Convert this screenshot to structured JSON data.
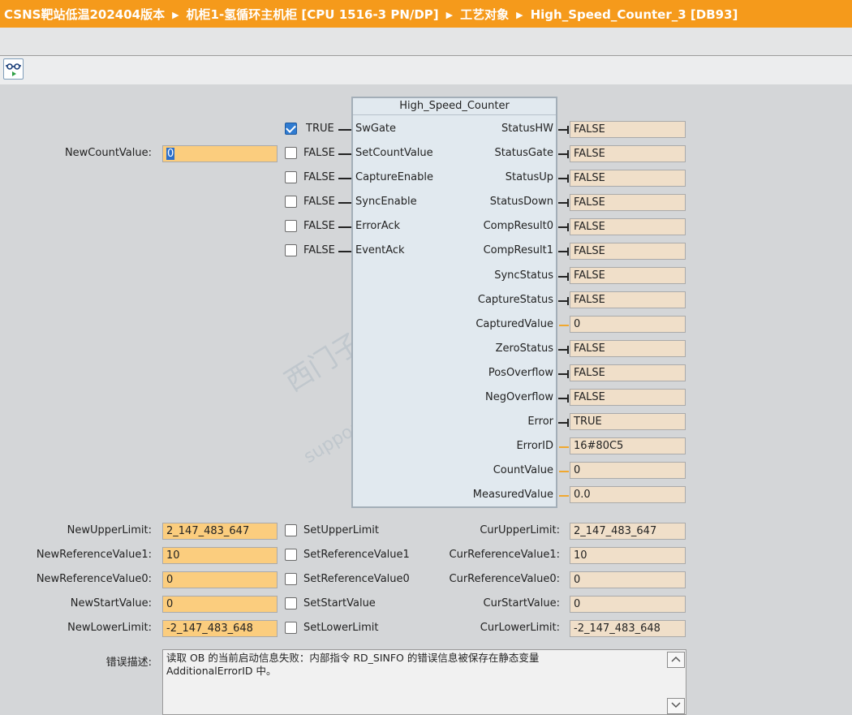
{
  "breadcrumb": {
    "items": [
      "CSNS靶站低温202404版本",
      "机柜1-氢循环主机柜 [CPU 1516-3 PN/DP]",
      "工艺对象",
      "High_Speed_Counter_3 [DB93]"
    ],
    "separator": "▶"
  },
  "toolbar": {
    "monitor_icon": "glasses-monitor-icon"
  },
  "block": {
    "title": "High_Speed_Counter",
    "inputs": [
      {
        "name": "SwGate",
        "value": "TRUE",
        "checked": true
      },
      {
        "name": "SetCountValue",
        "value": "FALSE",
        "checked": false
      },
      {
        "name": "CaptureEnable",
        "value": "FALSE",
        "checked": false
      },
      {
        "name": "SyncEnable",
        "value": "FALSE",
        "checked": false
      },
      {
        "name": "ErrorAck",
        "value": "FALSE",
        "checked": false
      },
      {
        "name": "EventAck",
        "value": "FALSE",
        "checked": false
      }
    ],
    "outputs": [
      {
        "name": "StatusHW",
        "value": "FALSE"
      },
      {
        "name": "StatusGate",
        "value": "FALSE"
      },
      {
        "name": "StatusUp",
        "value": "FALSE"
      },
      {
        "name": "StatusDown",
        "value": "FALSE"
      },
      {
        "name": "CompResult0",
        "value": "FALSE"
      },
      {
        "name": "CompResult1",
        "value": "FALSE"
      },
      {
        "name": "SyncStatus",
        "value": "FALSE"
      },
      {
        "name": "CaptureStatus",
        "value": "FALSE"
      },
      {
        "name": "CapturedValue",
        "value": "0"
      },
      {
        "name": "ZeroStatus",
        "value": "FALSE"
      },
      {
        "name": "PosOverflow",
        "value": "FALSE"
      },
      {
        "name": "NegOverflow",
        "value": "FALSE"
      },
      {
        "name": "Error",
        "value": "TRUE"
      },
      {
        "name": "ErrorID",
        "value": "16#80C5"
      },
      {
        "name": "CountValue",
        "value": "0"
      },
      {
        "name": "MeasuredValue",
        "value": "0.0"
      }
    ]
  },
  "new_count": {
    "label": "NewCountValue:",
    "value": "0"
  },
  "params": [
    {
      "label": "NewUpperLimit:",
      "value": "2_147_483_647",
      "set_label": "SetUpperLimit",
      "cur_label": "CurUpperLimit:",
      "cur_value": "2_147_483_647"
    },
    {
      "label": "NewReferenceValue1:",
      "value": "10",
      "set_label": "SetReferenceValue1",
      "cur_label": "CurReferenceValue1:",
      "cur_value": "10"
    },
    {
      "label": "NewReferenceValue0:",
      "value": "0",
      "set_label": "SetReferenceValue0",
      "cur_label": "CurReferenceValue0:",
      "cur_value": "0"
    },
    {
      "label": "NewStartValue:",
      "value": "0",
      "set_label": "SetStartValue",
      "cur_label": "CurStartValue:",
      "cur_value": "0"
    },
    {
      "label": "NewLowerLimit:",
      "value": "-2_147_483_648",
      "set_label": "SetLowerLimit",
      "cur_label": "CurLowerLimit:",
      "cur_value": "-2_147_483_648"
    }
  ],
  "error_desc": {
    "label": "错误描述:",
    "line1": "读取 OB 的当前启动信息失败：内部指令 RD_SINFO 的错误信息被保存在静态变量",
    "line2": "AdditionalErrorID 中。"
  },
  "watermark": {
    "line1": "西门子工业",
    "line2": "support.industry.siemens.com"
  },
  "colors": {
    "breadcrumb": "#f59a1b",
    "input_field": "#fbcd7e",
    "output_field": "#f0dfc9",
    "block": "#e1e9ef"
  }
}
